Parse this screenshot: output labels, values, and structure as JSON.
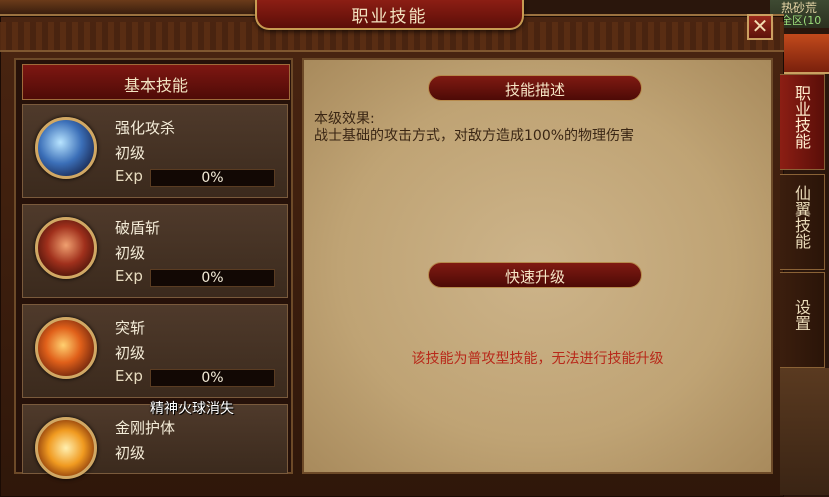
{
  "window": {
    "title": "职业技能",
    "close_symbol": "✕"
  },
  "background": {
    "top_right_name": "热砂荒",
    "top_right_zone": "全区(10"
  },
  "left_panel": {
    "header": "基本技能",
    "skills": [
      {
        "name": "强化攻杀",
        "level": "初级",
        "exp_label": "Exp",
        "exp_text": "0%",
        "exp_fraction": 0,
        "icon": "sword-slash-icon"
      },
      {
        "name": "破盾斩",
        "level": "初级",
        "exp_label": "Exp",
        "exp_text": "0%",
        "exp_fraction": 0,
        "icon": "shield-break-icon"
      },
      {
        "name": "突斩",
        "level": "初级",
        "exp_label": "Exp",
        "exp_text": "0%",
        "exp_fraction": 0,
        "icon": "dash-strike-icon"
      },
      {
        "name": "金刚护体",
        "level": "初级",
        "icon": "diamond-guard-icon"
      }
    ],
    "floating_message": "精神火球消失"
  },
  "detail": {
    "desc_header": "技能描述",
    "desc_label": "本级效果:",
    "desc_text": "战士基础的攻击方式，对敌方造成100%的物理伤害",
    "upgrade_header": "快速升级",
    "upgrade_note": "该技能为普攻型技能，无法进行技能升级"
  },
  "tabs": [
    {
      "label": "职业技能",
      "active": true
    },
    {
      "label": "仙翼技能",
      "active": false
    },
    {
      "label": "设置",
      "active": false
    }
  ],
  "colors": {
    "accent_red": "#801a12",
    "gold_border": "#c89b52",
    "warning_text": "#b8291a"
  }
}
